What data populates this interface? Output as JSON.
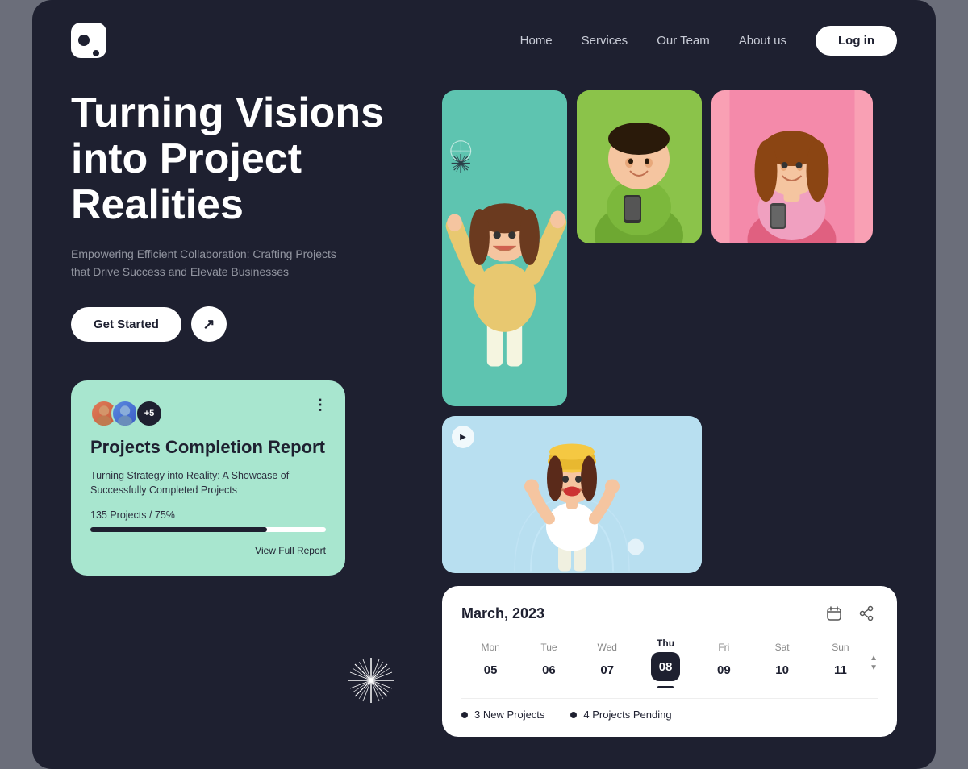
{
  "nav": {
    "links": [
      "Home",
      "Services",
      "Our Team",
      "About us"
    ],
    "login_label": "Log in"
  },
  "hero": {
    "title": "Turning Visions into Project Realities",
    "subtitle": "Empowering Efficient Collaboration: Crafting Projects that Drive Success and Elevate Businesses",
    "cta_label": "Get Started"
  },
  "completion_card": {
    "title": "Projects Completion Report",
    "description": "Turning Strategy into Reality: A Showcase of Successfully Completed Projects",
    "stats": "135 Projects / 75%",
    "progress": 75,
    "view_label": "View Full Report",
    "avatars_extra": "+5"
  },
  "calendar": {
    "title": "March, 2023",
    "days": [
      {
        "name": "Mon",
        "num": "05"
      },
      {
        "name": "Tue",
        "num": "06"
      },
      {
        "name": "Wed",
        "num": "07"
      },
      {
        "name": "Thu",
        "num": "08",
        "active": true
      },
      {
        "name": "Fri",
        "num": "09"
      },
      {
        "name": "Sat",
        "num": "10"
      },
      {
        "name": "Sun",
        "num": "11"
      }
    ],
    "events": [
      {
        "label": "3 New Projects"
      },
      {
        "label": "4 Projects Pending"
      }
    ]
  }
}
